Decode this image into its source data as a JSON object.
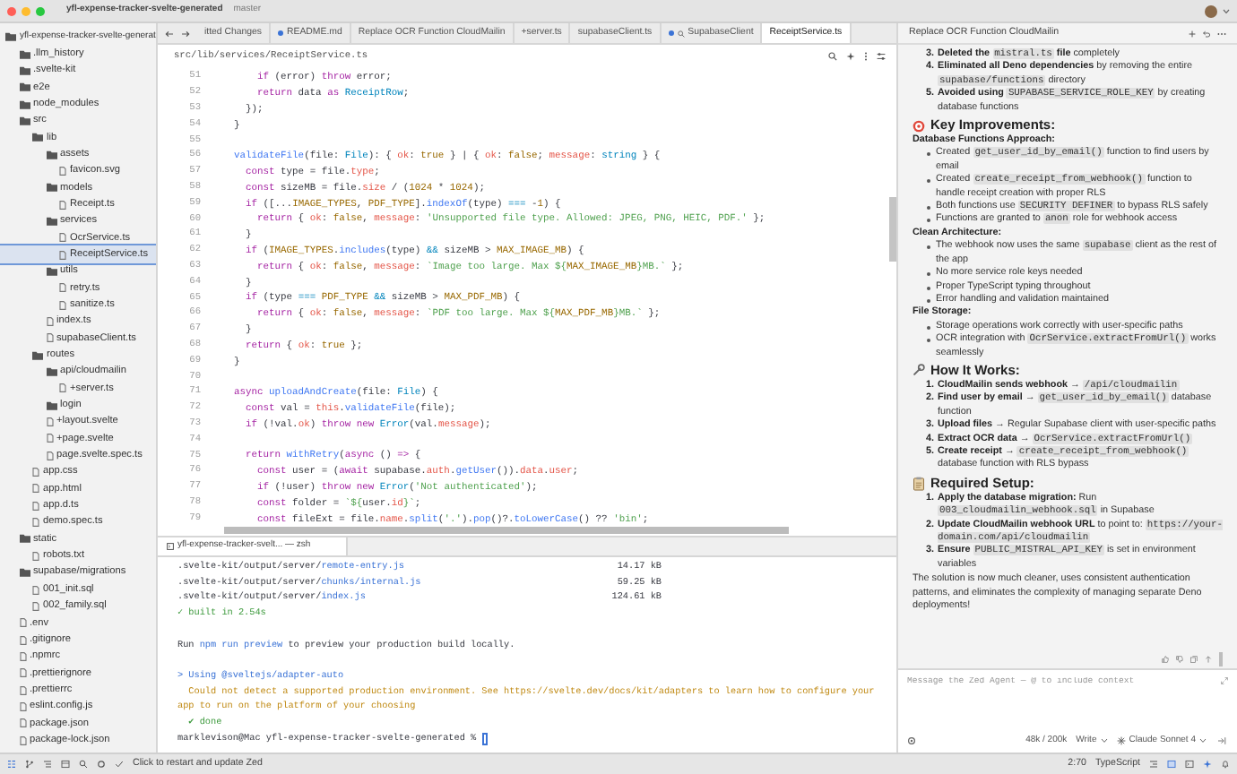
{
  "window": {
    "project": "yfl-expense-tracker-svelte-generated",
    "branch": "master"
  },
  "sidebar": {
    "tree": [
      {
        "label": "yfl-expense-tracker-svelte-generat",
        "kind": "folder",
        "selected": false,
        "children": [
          {
            "label": ".llm_history",
            "kind": "folder",
            "selected": false
          },
          {
            "label": ".svelte-kit",
            "kind": "folder",
            "selected": false
          },
          {
            "label": "e2e",
            "kind": "folder",
            "selected": false
          },
          {
            "label": "node_modules",
            "kind": "folder",
            "selected": false
          },
          {
            "label": "src",
            "kind": "folder",
            "selected": false,
            "children": [
              {
                "label": "lib",
                "kind": "folder",
                "selected": false,
                "children": [
                  {
                    "label": "assets",
                    "kind": "folder",
                    "selected": false,
                    "children": [
                      {
                        "label": "favicon.svg",
                        "kind": "file",
                        "selected": false
                      }
                    ]
                  },
                  {
                    "label": "models",
                    "kind": "folder",
                    "selected": false,
                    "children": [
                      {
                        "label": "Receipt.ts",
                        "kind": "file",
                        "selected": false
                      }
                    ]
                  },
                  {
                    "label": "services",
                    "kind": "folder",
                    "selected": false,
                    "children": [
                      {
                        "label": "OcrService.ts",
                        "kind": "file",
                        "selected": false
                      },
                      {
                        "label": "ReceiptService.ts",
                        "kind": "file",
                        "selected": true
                      }
                    ]
                  },
                  {
                    "label": "utils",
                    "kind": "folder",
                    "selected": false,
                    "children": [
                      {
                        "label": "retry.ts",
                        "kind": "file",
                        "selected": false
                      },
                      {
                        "label": "sanitize.ts",
                        "kind": "file",
                        "selected": false
                      }
                    ]
                  },
                  {
                    "label": "index.ts",
                    "kind": "file",
                    "selected": false
                  },
                  {
                    "label": "supabaseClient.ts",
                    "kind": "file",
                    "selected": false
                  }
                ]
              },
              {
                "label": "routes",
                "kind": "folder",
                "selected": false,
                "children": [
                  {
                    "label": "api/cloudmailin",
                    "kind": "folder",
                    "selected": false,
                    "children": [
                      {
                        "label": "+server.ts",
                        "kind": "file",
                        "selected": false
                      }
                    ]
                  },
                  {
                    "label": "login",
                    "kind": "folder",
                    "selected": false
                  },
                  {
                    "label": "+layout.svelte",
                    "kind": "file",
                    "selected": false
                  },
                  {
                    "label": "+page.svelte",
                    "kind": "file",
                    "selected": false
                  },
                  {
                    "label": "page.svelte.spec.ts",
                    "kind": "file",
                    "selected": false
                  }
                ]
              },
              {
                "label": "app.css",
                "kind": "file",
                "selected": false
              },
              {
                "label": "app.html",
                "kind": "file",
                "selected": false
              },
              {
                "label": "app.d.ts",
                "kind": "file",
                "selected": false
              },
              {
                "label": "demo.spec.ts",
                "kind": "file",
                "selected": false
              }
            ]
          },
          {
            "label": "static",
            "kind": "folder",
            "selected": false,
            "children": [
              {
                "label": "robots.txt",
                "kind": "file",
                "selected": false
              }
            ]
          },
          {
            "label": "supabase/migrations",
            "kind": "folder",
            "selected": false,
            "children": [
              {
                "label": "001_init.sql",
                "kind": "file",
                "selected": false
              },
              {
                "label": "002_family.sql",
                "kind": "file",
                "selected": false
              }
            ]
          },
          {
            "label": ".env",
            "kind": "file",
            "selected": false
          },
          {
            "label": ".gitignore",
            "kind": "file",
            "selected": false
          },
          {
            "label": ".npmrc",
            "kind": "file",
            "selected": false
          },
          {
            "label": ".prettierignore",
            "kind": "file",
            "selected": false
          },
          {
            "label": ".prettierrc",
            "kind": "file",
            "selected": false
          },
          {
            "label": "eslint.config.js",
            "kind": "file",
            "selected": false
          },
          {
            "label": "package.json",
            "kind": "file",
            "selected": false
          },
          {
            "label": "package-lock.json",
            "kind": "file",
            "selected": false
          }
        ]
      }
    ]
  },
  "tabs": [
    {
      "label": "itted Changes",
      "kind": "file",
      "selected": false,
      "modified": false
    },
    {
      "label": "README.md",
      "kind": "file",
      "selected": false,
      "modified": true
    },
    {
      "label": "Replace OCR Function CloudMailin",
      "kind": "file",
      "selected": false,
      "modified": false
    },
    {
      "label": "+server.ts",
      "kind": "file",
      "selected": false,
      "modified": false
    },
    {
      "label": "supabaseClient.ts",
      "kind": "file",
      "selected": false,
      "modified": false
    },
    {
      "label": "SupabaseClient",
      "kind": "search",
      "selected": false,
      "modified": true
    },
    {
      "label": "ReceiptService.ts",
      "kind": "file",
      "selected": true,
      "modified": false
    }
  ],
  "editor": {
    "path": "src/lib/services/ReceiptService.ts",
    "lines": [
      {
        "number": "51",
        "segments": [
          {
            "text": "      if",
            "kind": "kw"
          },
          {
            "text": " (error) ",
            "kind": "plain"
          },
          {
            "text": "throw",
            "kind": "kw"
          },
          {
            "text": " error;",
            "kind": "plain"
          }
        ]
      },
      {
        "number": "52",
        "segments": [
          {
            "text": "      return",
            "kind": "kw"
          },
          {
            "text": " data ",
            "kind": "plain"
          },
          {
            "text": "as",
            "kind": "kw"
          },
          {
            "text": " ReceiptRow",
            "kind": "type"
          },
          {
            "text": ";",
            "kind": "plain"
          }
        ]
      },
      {
        "number": "53",
        "segments": [
          {
            "text": "    });",
            "kind": "plain"
          }
        ]
      },
      {
        "number": "54",
        "segments": [
          {
            "text": "  }",
            "kind": "plain"
          }
        ]
      },
      {
        "number": "55"
      },
      {
        "number": "56",
        "segments": [
          {
            "text": "  validateFile",
            "kind": "fn"
          },
          {
            "text": "(file: ",
            "kind": "plain"
          },
          {
            "text": "File",
            "kind": "type"
          },
          {
            "text": "): { ",
            "kind": "plain"
          },
          {
            "text": "ok",
            "kind": "prop"
          },
          {
            "text": ": ",
            "kind": "plain"
          },
          {
            "text": "true",
            "kind": "const"
          },
          {
            "text": " } | { ",
            "kind": "plain"
          },
          {
            "text": "ok",
            "kind": "prop"
          },
          {
            "text": ": ",
            "kind": "plain"
          },
          {
            "text": "false",
            "kind": "const"
          },
          {
            "text": "; ",
            "kind": "plain"
          },
          {
            "text": "message",
            "kind": "prop"
          },
          {
            "text": ": ",
            "kind": "plain"
          },
          {
            "text": "string",
            "kind": "type"
          },
          {
            "text": " } {",
            "kind": "plain"
          }
        ]
      },
      {
        "number": "57",
        "segments": [
          {
            "text": "    const",
            "kind": "kw"
          },
          {
            "text": " type = file.",
            "kind": "plain"
          },
          {
            "text": "type",
            "kind": "prop"
          },
          {
            "text": ";",
            "kind": "plain"
          }
        ]
      },
      {
        "number": "58",
        "segments": [
          {
            "text": "    const",
            "kind": "kw"
          },
          {
            "text": " sizeMB = file.",
            "kind": "plain"
          },
          {
            "text": "size",
            "kind": "prop"
          },
          {
            "text": " / (",
            "kind": "plain"
          },
          {
            "text": "1024",
            "kind": "const"
          },
          {
            "text": " * ",
            "kind": "plain"
          },
          {
            "text": "1024",
            "kind": "const"
          },
          {
            "text": ");",
            "kind": "plain"
          }
        ]
      },
      {
        "number": "59",
        "segments": [
          {
            "text": "    if",
            "kind": "kw"
          },
          {
            "text": " ([...",
            "kind": "plain"
          },
          {
            "text": "IMAGE_TYPES",
            "kind": "const"
          },
          {
            "text": ", ",
            "kind": "plain"
          },
          {
            "text": "PDF_TYPE",
            "kind": "const"
          },
          {
            "text": "].",
            "kind": "plain"
          },
          {
            "text": "indexOf",
            "kind": "fn"
          },
          {
            "text": "(type) ",
            "kind": "plain"
          },
          {
            "text": "===",
            "kind": "op"
          },
          {
            "text": " -",
            "kind": "plain"
          },
          {
            "text": "1",
            "kind": "const"
          },
          {
            "text": ") {",
            "kind": "plain"
          }
        ]
      },
      {
        "number": "60",
        "segments": [
          {
            "text": "      return",
            "kind": "kw"
          },
          {
            "text": " { ",
            "kind": "plain"
          },
          {
            "text": "ok",
            "kind": "prop"
          },
          {
            "text": ": ",
            "kind": "plain"
          },
          {
            "text": "false",
            "kind": "const"
          },
          {
            "text": ", ",
            "kind": "plain"
          },
          {
            "text": "message",
            "kind": "prop"
          },
          {
            "text": ": ",
            "kind": "plain"
          },
          {
            "text": "'Unsupported file type. Allowed: JPEG, PNG, HEIC, PDF.'",
            "kind": "str"
          },
          {
            "text": " };",
            "kind": "plain"
          }
        ]
      },
      {
        "number": "61",
        "segments": [
          {
            "text": "    }",
            "kind": "plain"
          }
        ]
      },
      {
        "number": "62",
        "segments": [
          {
            "text": "    if",
            "kind": "kw"
          },
          {
            "text": " (",
            "kind": "plain"
          },
          {
            "text": "IMAGE_TYPES",
            "kind": "const"
          },
          {
            "text": ".",
            "kind": "plain"
          },
          {
            "text": "includes",
            "kind": "fn"
          },
          {
            "text": "(type) ",
            "kind": "plain"
          },
          {
            "text": "&&",
            "kind": "op"
          },
          {
            "text": " sizeMB > ",
            "kind": "plain"
          },
          {
            "text": "MAX_IMAGE_MB",
            "kind": "const"
          },
          {
            "text": ") {",
            "kind": "plain"
          }
        ]
      },
      {
        "number": "63",
        "segments": [
          {
            "text": "      return",
            "kind": "kw"
          },
          {
            "text": " { ",
            "kind": "plain"
          },
          {
            "text": "ok",
            "kind": "prop"
          },
          {
            "text": ": ",
            "kind": "plain"
          },
          {
            "text": "false",
            "kind": "const"
          },
          {
            "text": ", ",
            "kind": "plain"
          },
          {
            "text": "message",
            "kind": "prop"
          },
          {
            "text": ": ",
            "kind": "plain"
          },
          {
            "text": "`Image too large. Max ${",
            "kind": "str"
          },
          {
            "text": "MAX_IMAGE_MB",
            "kind": "const"
          },
          {
            "text": "}MB.`",
            "kind": "str"
          },
          {
            "text": " };",
            "kind": "plain"
          }
        ]
      },
      {
        "number": "64",
        "segments": [
          {
            "text": "    }",
            "kind": "plain"
          }
        ]
      },
      {
        "number": "65",
        "segments": [
          {
            "text": "    if",
            "kind": "kw"
          },
          {
            "text": " (type ",
            "kind": "plain"
          },
          {
            "text": "=== ",
            "kind": "op"
          },
          {
            "text": "PDF_TYPE ",
            "kind": "const"
          },
          {
            "text": "&&",
            "kind": "op"
          },
          {
            "text": " sizeMB > ",
            "kind": "plain"
          },
          {
            "text": "MAX_PDF_MB",
            "kind": "const"
          },
          {
            "text": ") {",
            "kind": "plain"
          }
        ]
      },
      {
        "number": "66",
        "segments": [
          {
            "text": "      return",
            "kind": "kw"
          },
          {
            "text": " { ",
            "kind": "plain"
          },
          {
            "text": "ok",
            "kind": "prop"
          },
          {
            "text": ": ",
            "kind": "plain"
          },
          {
            "text": "false",
            "kind": "const"
          },
          {
            "text": ", ",
            "kind": "plain"
          },
          {
            "text": "message",
            "kind": "prop"
          },
          {
            "text": ": ",
            "kind": "plain"
          },
          {
            "text": "`PDF too large. Max ${",
            "kind": "str"
          },
          {
            "text": "MAX_PDF_MB",
            "kind": "const"
          },
          {
            "text": "}MB.`",
            "kind": "str"
          },
          {
            "text": " };",
            "kind": "plain"
          }
        ]
      },
      {
        "number": "67",
        "segments": [
          {
            "text": "    }",
            "kind": "plain"
          }
        ]
      },
      {
        "number": "68",
        "segments": [
          {
            "text": "    return",
            "kind": "kw"
          },
          {
            "text": " { ",
            "kind": "plain"
          },
          {
            "text": "ok",
            "kind": "prop"
          },
          {
            "text": ": ",
            "kind": "plain"
          },
          {
            "text": "true",
            "kind": "const"
          },
          {
            "text": " };",
            "kind": "plain"
          }
        ]
      },
      {
        "number": "69",
        "segments": [
          {
            "text": "  }",
            "kind": "plain"
          }
        ]
      },
      {
        "number": "70"
      },
      {
        "number": "71",
        "segments": [
          {
            "text": "  async ",
            "kind": "kw"
          },
          {
            "text": "uploadAndCreate",
            "kind": "fn"
          },
          {
            "text": "(file: ",
            "kind": "plain"
          },
          {
            "text": "File",
            "kind": "type"
          },
          {
            "text": ") {",
            "kind": "plain"
          }
        ]
      },
      {
        "number": "72",
        "segments": [
          {
            "text": "    const",
            "kind": "kw"
          },
          {
            "text": " val = ",
            "kind": "plain"
          },
          {
            "text": "this",
            "kind": "prop"
          },
          {
            "text": ".",
            "kind": "plain"
          },
          {
            "text": "validateFile",
            "kind": "fn"
          },
          {
            "text": "(file);",
            "kind": "plain"
          }
        ]
      },
      {
        "number": "73",
        "segments": [
          {
            "text": "    if",
            "kind": "kw"
          },
          {
            "text": " (!val.",
            "kind": "plain"
          },
          {
            "text": "ok",
            "kind": "prop"
          },
          {
            "text": ") ",
            "kind": "plain"
          },
          {
            "text": "throw new ",
            "kind": "kw"
          },
          {
            "text": "Error",
            "kind": "type"
          },
          {
            "text": "(val.",
            "kind": "plain"
          },
          {
            "text": "message",
            "kind": "prop"
          },
          {
            "text": ");",
            "kind": "plain"
          }
        ]
      },
      {
        "number": "74"
      },
      {
        "number": "75",
        "segments": [
          {
            "text": "    return ",
            "kind": "kw"
          },
          {
            "text": "withRetry",
            "kind": "fn"
          },
          {
            "text": "(",
            "kind": "plain"
          },
          {
            "text": "async",
            "kind": "kw"
          },
          {
            "text": " () ",
            "kind": "plain"
          },
          {
            "text": "=>",
            "kind": "kw"
          },
          {
            "text": " {",
            "kind": "plain"
          }
        ]
      },
      {
        "number": "76",
        "segments": [
          {
            "text": "      const",
            "kind": "kw"
          },
          {
            "text": " user = (",
            "kind": "plain"
          },
          {
            "text": "await",
            "kind": "kw"
          },
          {
            "text": " supabase.",
            "kind": "plain"
          },
          {
            "text": "auth",
            "kind": "prop"
          },
          {
            "text": ".",
            "kind": "plain"
          },
          {
            "text": "getUser",
            "kind": "fn"
          },
          {
            "text": "()).",
            "kind": "plain"
          },
          {
            "text": "data",
            "kind": "prop"
          },
          {
            "text": ".",
            "kind": "plain"
          },
          {
            "text": "user",
            "kind": "prop"
          },
          {
            "text": ";",
            "kind": "plain"
          }
        ]
      },
      {
        "number": "77",
        "segments": [
          {
            "text": "      if",
            "kind": "kw"
          },
          {
            "text": " (!user) ",
            "kind": "plain"
          },
          {
            "text": "throw new ",
            "kind": "kw"
          },
          {
            "text": "Error",
            "kind": "type"
          },
          {
            "text": "(",
            "kind": "plain"
          },
          {
            "text": "'Not authenticated'",
            "kind": "str"
          },
          {
            "text": ");",
            "kind": "plain"
          }
        ]
      },
      {
        "number": "78",
        "segments": [
          {
            "text": "      const",
            "kind": "kw"
          },
          {
            "text": " folder = ",
            "kind": "plain"
          },
          {
            "text": "`${",
            "kind": "str"
          },
          {
            "text": "user.",
            "kind": "plain"
          },
          {
            "text": "id",
            "kind": "prop"
          },
          {
            "text": "}`",
            "kind": "str"
          },
          {
            "text": ";",
            "kind": "plain"
          }
        ]
      },
      {
        "number": "79",
        "segments": [
          {
            "text": "      const",
            "kind": "kw"
          },
          {
            "text": " fileExt = file.",
            "kind": "plain"
          },
          {
            "text": "name",
            "kind": "prop"
          },
          {
            "text": ".",
            "kind": "plain"
          },
          {
            "text": "split",
            "kind": "fn"
          },
          {
            "text": "(",
            "kind": "plain"
          },
          {
            "text": "'.'",
            "kind": "str"
          },
          {
            "text": ").",
            "kind": "plain"
          },
          {
            "text": "pop",
            "kind": "fn"
          },
          {
            "text": "()?.",
            "kind": "plain"
          },
          {
            "text": "toLowerCase",
            "kind": "fn"
          },
          {
            "text": "() ?? ",
            "kind": "plain"
          },
          {
            "text": "'bin'",
            "kind": "str"
          },
          {
            "text": ";",
            "kind": "plain"
          }
        ]
      }
    ]
  },
  "terminal": {
    "title": "yfl-expense-tracker-svelt... — zsh",
    "lines": [
      {
        "kind": "output",
        "segments": [
          {
            "text": ".svelte-kit/output/server/",
            "kind": "plain"
          },
          {
            "text": "remote-entry.js",
            "kind": "link"
          }
        ],
        "size": "14.17 kB"
      },
      {
        "kind": "output",
        "segments": [
          {
            "text": ".svelte-kit/output/server/",
            "kind": "plain"
          },
          {
            "text": "chunks/internal.js",
            "kind": "link"
          }
        ],
        "size": "59.25 kB"
      },
      {
        "kind": "output",
        "segments": [
          {
            "text": ".svelte-kit/output/server/",
            "kind": "plain"
          },
          {
            "text": "index.js",
            "kind": "link"
          }
        ],
        "size": "124.61 kB"
      },
      {
        "kind": "output",
        "segments": [
          {
            "text": "✓ built in 2.54s",
            "kind": "success"
          }
        ]
      },
      {
        "kind": "blank"
      },
      {
        "kind": "output",
        "segments": [
          {
            "text": "Run ",
            "kind": "plain"
          },
          {
            "text": "npm run preview",
            "kind": "link"
          },
          {
            "text": " to preview your production build locally.",
            "kind": "plain"
          }
        ]
      },
      {
        "kind": "blank"
      },
      {
        "kind": "output",
        "segments": [
          {
            "text": "> Using @sveltejs/adapter-auto",
            "kind": "info"
          }
        ]
      },
      {
        "kind": "output",
        "segments": [
          {
            "text": "  Could not detect a supported production environment. See https://svelte.dev/docs/kit/adapters to learn how to configure your app to run on the platform of your choosing",
            "kind": "warning"
          }
        ]
      },
      {
        "kind": "output",
        "segments": [
          {
            "text": "  ✔ done",
            "kind": "success"
          }
        ]
      },
      {
        "kind": "prompt",
        "segments": [
          {
            "text": "marklevison@Mac yfl-expense-tracker-svelte-generated % ",
            "kind": "plain"
          }
        ]
      }
    ]
  },
  "agent": {
    "title": "Replace OCR Function CloudMailin",
    "blocks": [
      {
        "kind": "ordered",
        "number": "3.",
        "segments": [
          {
            "text": "Deleted the ",
            "kind": "bold"
          },
          {
            "text": "mistral.ts",
            "kind": "code"
          },
          {
            "text": " file",
            "kind": "bold"
          },
          {
            "text": " completely",
            "kind": "plain"
          }
        ]
      },
      {
        "kind": "ordered",
        "number": "4.",
        "segments": [
          {
            "text": "Eliminated all Deno dependencies",
            "kind": "bold"
          },
          {
            "text": " by removing the entire ",
            "kind": "plain"
          },
          {
            "text": "supabase/functions",
            "kind": "code"
          },
          {
            "text": " directory",
            "kind": "plain"
          }
        ]
      },
      {
        "kind": "ordered",
        "number": "5.",
        "segments": [
          {
            "text": "Avoided using ",
            "kind": "bold"
          },
          {
            "text": "SUPABASE_SERVICE_ROLE_KEY",
            "kind": "code"
          },
          {
            "text": " by creating database functions",
            "kind": "plain"
          }
        ]
      },
      {
        "kind": "heading",
        "segments": [
          {
            "text": "Key Improvements:",
            "kind": "bold"
          }
        ]
      },
      {
        "kind": "subheading",
        "segments": [
          {
            "text": "Database Functions Approach:",
            "kind": "bold"
          }
        ]
      },
      {
        "kind": "bullet",
        "segments": [
          {
            "text": "Created ",
            "kind": "plain"
          },
          {
            "text": "get_user_id_by_email()",
            "kind": "code"
          },
          {
            "text": " function to find users by email",
            "kind": "plain"
          }
        ]
      },
      {
        "kind": "bullet",
        "segments": [
          {
            "text": "Created ",
            "kind": "plain"
          },
          {
            "text": "create_receipt_from_webhook()",
            "kind": "code"
          },
          {
            "text": " function to handle receipt creation with proper RLS",
            "kind": "plain"
          }
        ]
      },
      {
        "kind": "bullet",
        "segments": [
          {
            "text": "Both functions use ",
            "kind": "plain"
          },
          {
            "text": "SECURITY DEFINER",
            "kind": "code"
          },
          {
            "text": " to bypass RLS safely",
            "kind": "plain"
          }
        ]
      },
      {
        "kind": "bullet",
        "segments": [
          {
            "text": "Functions are granted to ",
            "kind": "plain"
          },
          {
            "text": "anon",
            "kind": "code"
          },
          {
            "text": " role for webhook access",
            "kind": "plain"
          }
        ]
      },
      {
        "kind": "subheading",
        "segments": [
          {
            "text": "Clean Architecture:",
            "kind": "bold"
          }
        ]
      },
      {
        "kind": "bullet",
        "segments": [
          {
            "text": "The webhook now uses the same ",
            "kind": "plain"
          },
          {
            "text": "supabase",
            "kind": "code"
          },
          {
            "text": " client as the rest of the app",
            "kind": "plain"
          }
        ]
      },
      {
        "kind": "bullet",
        "segments": [
          {
            "text": "No more service role keys needed",
            "kind": "plain"
          }
        ]
      },
      {
        "kind": "bullet",
        "segments": [
          {
            "text": "Proper TypeScript typing throughout",
            "kind": "plain"
          }
        ]
      },
      {
        "kind": "bullet",
        "segments": [
          {
            "text": "Error handling and validation maintained",
            "kind": "plain"
          }
        ]
      },
      {
        "kind": "subheading",
        "segments": [
          {
            "text": "File Storage:",
            "kind": "bold"
          }
        ]
      },
      {
        "kind": "bullet",
        "segments": [
          {
            "text": "Storage operations work correctly with user-specific paths",
            "kind": "plain"
          }
        ]
      },
      {
        "kind": "bullet",
        "segments": [
          {
            "text": "OCR integration with ",
            "kind": "plain"
          },
          {
            "text": "OcrService.extractFromUrl()",
            "kind": "code"
          },
          {
            "text": " works seamlessly",
            "kind": "plain"
          }
        ]
      },
      {
        "kind": "heading",
        "segments": [
          {
            "text": "How It Works:",
            "kind": "bold"
          }
        ]
      },
      {
        "kind": "ordered",
        "number": "1.",
        "segments": [
          {
            "text": "CloudMailin sends webhook",
            "kind": "bold"
          },
          {
            "text": " → ",
            "kind": "plain"
          },
          {
            "text": "/api/cloudmailin",
            "kind": "code"
          }
        ]
      },
      {
        "kind": "ordered",
        "number": "2.",
        "segments": [
          {
            "text": "Find user by email",
            "kind": "bold"
          },
          {
            "text": " → ",
            "kind": "plain"
          },
          {
            "text": "get_user_id_by_email()",
            "kind": "code"
          },
          {
            "text": " database function",
            "kind": "plain"
          }
        ]
      },
      {
        "kind": "ordered",
        "number": "3.",
        "segments": [
          {
            "text": "Upload files",
            "kind": "bold"
          },
          {
            "text": " → Regular Supabase client with user-specific paths",
            "kind": "plain"
          }
        ]
      },
      {
        "kind": "ordered",
        "number": "4.",
        "segments": [
          {
            "text": "Extract OCR data",
            "kind": "bold"
          },
          {
            "text": " → ",
            "kind": "plain"
          },
          {
            "text": "OcrService.extractFromUrl()",
            "kind": "code"
          }
        ]
      },
      {
        "kind": "ordered",
        "number": "5.",
        "segments": [
          {
            "text": "Create receipt",
            "kind": "bold"
          },
          {
            "text": " → ",
            "kind": "plain"
          },
          {
            "text": "create_receipt_from_webhook()",
            "kind": "code"
          },
          {
            "text": " database function with RLS bypass",
            "kind": "plain"
          }
        ]
      },
      {
        "kind": "heading",
        "segments": [
          {
            "text": "Required Setup:",
            "kind": "bold"
          }
        ]
      },
      {
        "kind": "ordered",
        "number": "1.",
        "segments": [
          {
            "text": "Apply the database migration:",
            "kind": "bold"
          },
          {
            "text": " Run ",
            "kind": "plain"
          },
          {
            "text": "003_cloudmailin_webhook.sql",
            "kind": "code"
          },
          {
            "text": " in Supabase",
            "kind": "plain"
          }
        ]
      },
      {
        "kind": "ordered",
        "number": "2.",
        "segments": [
          {
            "text": "Update CloudMailin webhook URL",
            "kind": "bold"
          },
          {
            "text": " to point to: ",
            "kind": "plain"
          },
          {
            "text": "https://your-domain.com/api/cloudmailin",
            "kind": "code"
          }
        ]
      },
      {
        "kind": "ordered",
        "number": "3.",
        "segments": [
          {
            "text": "Ensure ",
            "kind": "bold"
          },
          {
            "text": "PUBLIC_MISTRAL_API_KEY",
            "kind": "code"
          },
          {
            "text": " is set in environment variables",
            "kind": "plain"
          }
        ]
      },
      {
        "kind": "paragraph",
        "segments": [
          {
            "text": "The solution is now much cleaner, uses consistent authentication patterns, and eliminates the complexity of managing separate Deno deployments!",
            "kind": "plain"
          }
        ]
      }
    ],
    "placeholder": "Message the Zed Agent — @ to include context",
    "token_usage": "48k / 200k",
    "mode": "Write",
    "model": "Claude Sonnet 4"
  },
  "status_bar": {
    "message": "Click to restart and update Zed",
    "cursor_position": "2:70",
    "language": "TypeScript"
  }
}
